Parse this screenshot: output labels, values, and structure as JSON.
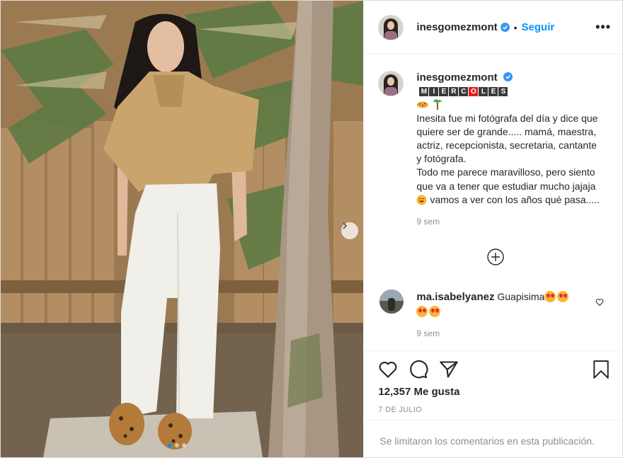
{
  "post": {
    "username": "inesgomezmont",
    "follow_label": "Seguir",
    "separator": "•",
    "more_label": "•••",
    "colors": {
      "accent": "#0095f6",
      "muted": "#8e8e8e",
      "text": "#262626"
    }
  },
  "caption": {
    "username": "inesgomezmont",
    "weekday_tiles": [
      "M",
      "I",
      "E",
      "R",
      "C",
      "O",
      "L",
      "E",
      "S"
    ],
    "emoji_icons": [
      "leopard-icon",
      "palm-tree-icon"
    ],
    "lines": [
      "Inesita fue mi fotógrafa del día y dice que quiere ser de grande..... mamá, maestra, actriz, recepcionista, secretaria, cantante y fotógrafa.",
      "Todo me parece maravilloso, pero siento que va a tener que estudiar mucho jajaja",
      "vamos a ver con los años qué pasa....."
    ],
    "time": "9 sem"
  },
  "comments": [
    {
      "username": "ma.isabelyanez",
      "text": "Guapisima",
      "emoji_count": 4,
      "time": "9 sem"
    }
  ],
  "stats": {
    "likes": "12,357 Me gusta",
    "date": "7 DE JULIO",
    "comments_limited": "Se limitaron los comentarios en esta publicación."
  },
  "carousel": {
    "total": 3,
    "active_index": 0
  }
}
